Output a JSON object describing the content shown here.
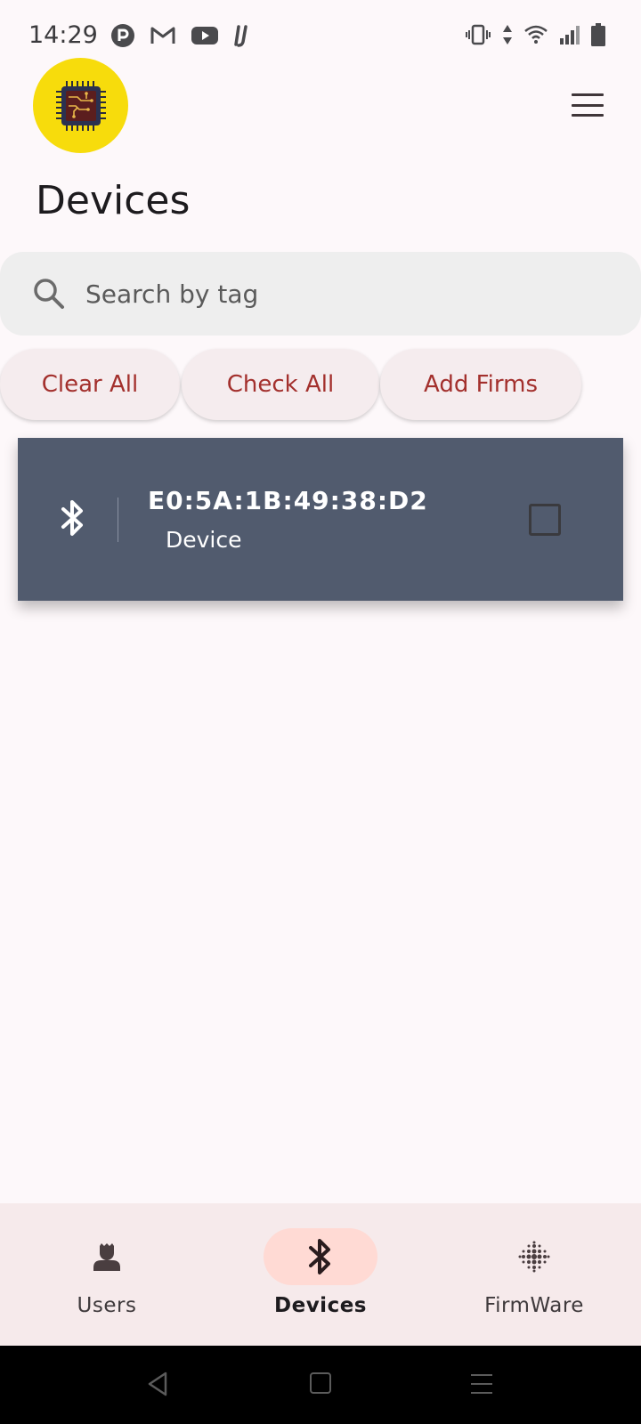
{
  "status_bar": {
    "time": "14:29",
    "app_icons": [
      "tethering-icon",
      "gmail-icon",
      "youtube-icon",
      "intellij-icon"
    ],
    "system_icons": [
      "vibrate-icon",
      "data-arrows-icon",
      "wifi-icon",
      "signal-icon",
      "battery-icon"
    ]
  },
  "header": {
    "logo_icon": "chip-icon",
    "logo_color": "#f7dc0c",
    "menu_icon": "hamburger-menu-icon",
    "title": "Devices"
  },
  "search": {
    "placeholder": "Search by tag",
    "value": ""
  },
  "actions": {
    "clear_all": "Clear All",
    "check_all": "Check All",
    "add_firms": "Add Firms",
    "accent_color": "#a3302d"
  },
  "devices": [
    {
      "icon": "bluetooth-icon",
      "mac": "E0:5A:1B:49:38:D2",
      "type": "Device",
      "checked": false,
      "card_color": "#515b6e"
    }
  ],
  "bottom_nav": {
    "items": [
      {
        "label": "Users",
        "icon": "user-icon",
        "active": false
      },
      {
        "label": "Devices",
        "icon": "bluetooth-icon",
        "active": true
      },
      {
        "label": "FirmWare",
        "icon": "dots-grid-icon",
        "active": false
      }
    ],
    "active_pill_color": "#ffdad4"
  },
  "system_nav": [
    "back-icon",
    "home-icon",
    "recents-icon"
  ]
}
